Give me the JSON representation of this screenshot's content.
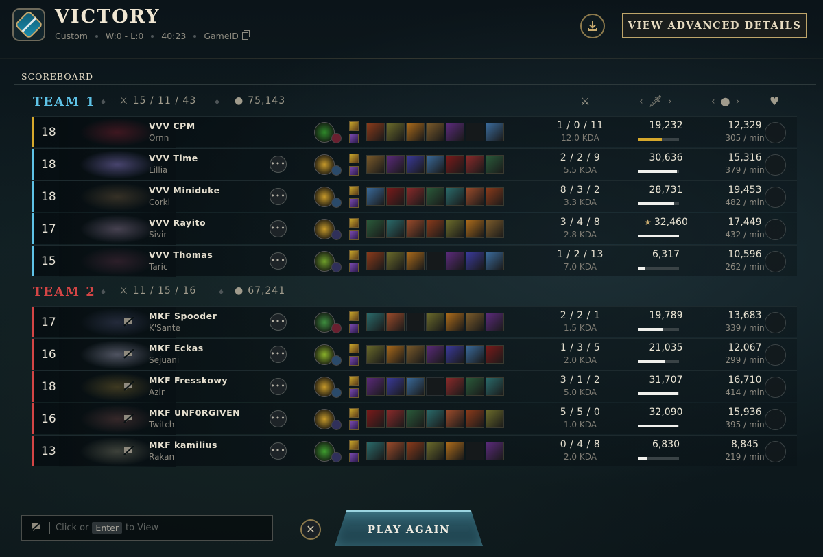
{
  "header": {
    "result": "VICTORY",
    "mode": "Custom",
    "record": "W:0 - L:0",
    "duration": "40:23",
    "game_id_label": "GameID",
    "advanced_label": "VIEW ADVANCED DETAILS",
    "scoreboard_tab": "SCOREBOARD"
  },
  "colors": {
    "team1": "#5ec2e6",
    "team2": "#d44545",
    "gold_bar": "#d6a82c",
    "accent": "#c8aa6e"
  },
  "team1": {
    "name": "TEAM 1",
    "kda": "15 / 11 / 43",
    "gold": "75,143",
    "players": [
      {
        "level": "18",
        "name": "VVV CPM",
        "champion": "Ornn",
        "kda": "1 / 0 / 11",
        "kda_ratio": "12.0 KDA",
        "damage": "19,232",
        "damage_fraction": 0.59,
        "gold": "12,329",
        "gold_rate": "305 / min",
        "highlight": true
      },
      {
        "level": "18",
        "name": "VVV Time",
        "champion": "Lillia",
        "kda": "2 / 2 / 9",
        "kda_ratio": "5.5 KDA",
        "damage": "30,636",
        "damage_fraction": 0.95,
        "gold": "15,316",
        "gold_rate": "379 / min"
      },
      {
        "level": "18",
        "name": "VVV Miniduke",
        "champion": "Corki",
        "kda": "8 / 3 / 2",
        "kda_ratio": "3.3 KDA",
        "damage": "28,731",
        "damage_fraction": 0.89,
        "gold": "19,453",
        "gold_rate": "482 / min"
      },
      {
        "level": "17",
        "name": "VVV Rayito",
        "champion": "Sivir",
        "kda": "3 / 4 / 8",
        "kda_ratio": "2.8 KDA",
        "damage": "32,460",
        "damage_fraction": 1.0,
        "gold": "17,449",
        "gold_rate": "432 / min",
        "top_damage_star": "★"
      },
      {
        "level": "15",
        "name": "VVV Thomas",
        "champion": "Taric",
        "kda": "1 / 2 / 13",
        "kda_ratio": "7.0 KDA",
        "damage": "6,317",
        "damage_fraction": 0.19,
        "gold": "10,596",
        "gold_rate": "262 / min"
      }
    ]
  },
  "team2": {
    "name": "TEAM 2",
    "kda": "11 / 15 / 16",
    "gold": "67,241",
    "players": [
      {
        "level": "17",
        "name": "MKF Spooder",
        "champion": "K'Sante",
        "kda": "2 / 2 / 1",
        "kda_ratio": "1.5 KDA",
        "damage": "19,789",
        "damage_fraction": 0.61,
        "gold": "13,683",
        "gold_rate": "339 / min"
      },
      {
        "level": "16",
        "name": "MKF Eckas",
        "champion": "Sejuani",
        "kda": "1 / 3 / 5",
        "kda_ratio": "2.0 KDA",
        "damage": "21,035",
        "damage_fraction": 0.65,
        "gold": "12,067",
        "gold_rate": "299 / min"
      },
      {
        "level": "18",
        "name": "MKF Fresskowy",
        "champion": "Azir",
        "kda": "3 / 1 / 2",
        "kda_ratio": "5.0 KDA",
        "damage": "31,707",
        "damage_fraction": 0.98,
        "gold": "16,710",
        "gold_rate": "414 / min"
      },
      {
        "level": "16",
        "name": "MKF UNF0RGIVEN",
        "champion": "Twitch",
        "kda": "5 / 5 / 0",
        "kda_ratio": "1.0 KDA",
        "damage": "32,090",
        "damage_fraction": 0.99,
        "gold": "15,936",
        "gold_rate": "395 / min"
      },
      {
        "level": "13",
        "name": "MKF kamilius",
        "champion": "Rakan",
        "kda": "0 / 4 / 8",
        "kda_ratio": "2.0 KDA",
        "damage": "6,830",
        "damage_fraction": 0.21,
        "gold": "8,845",
        "gold_rate": "219 / min"
      }
    ]
  },
  "columns": {
    "kda_icon": "crossed-swords-icon",
    "damage_icon": "sword-icon",
    "gold_icon": "gold-coins-icon",
    "honor_icon": "honor-heart-icon"
  },
  "chat": {
    "prefix": "Click or",
    "key": "Enter",
    "suffix": "to View"
  },
  "play_again": "PLAY AGAIN"
}
